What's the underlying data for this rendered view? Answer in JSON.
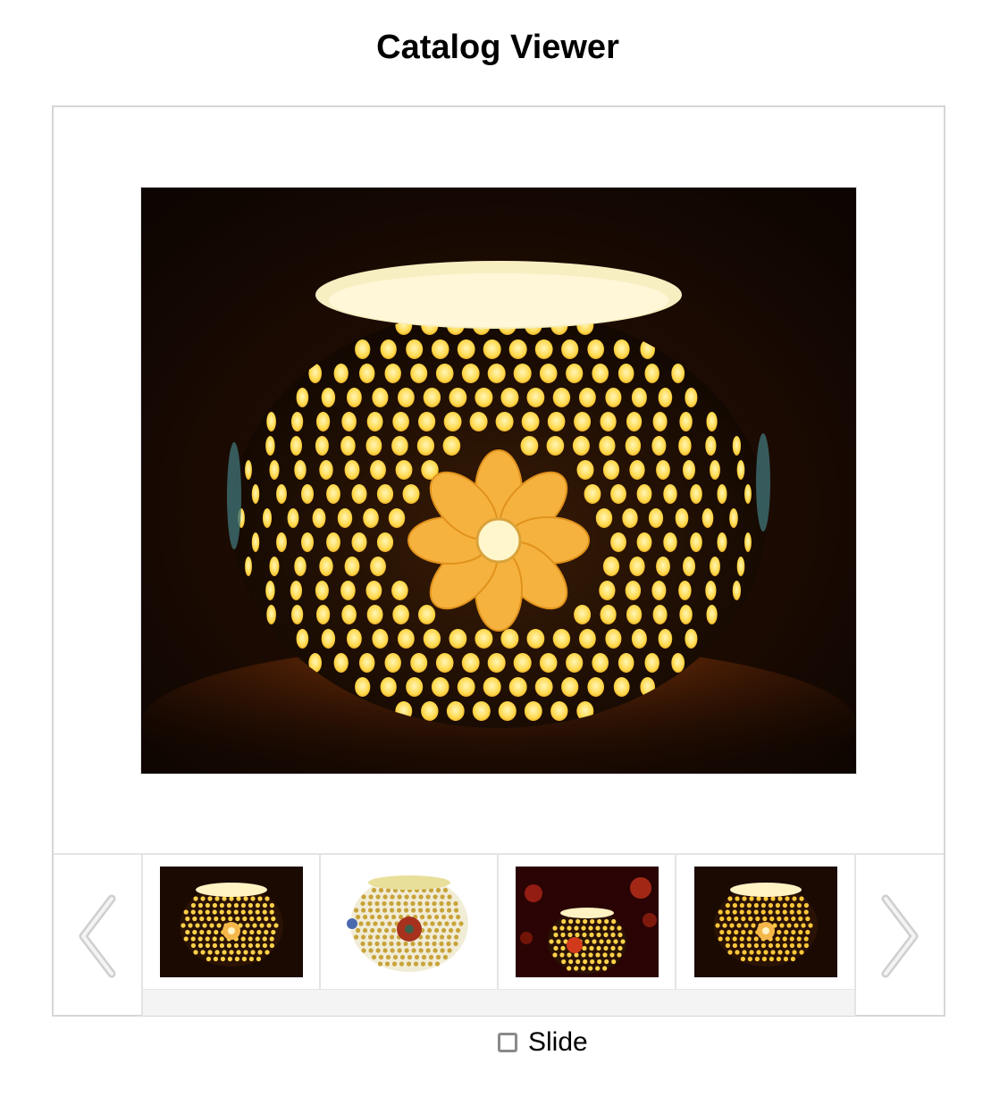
{
  "title": "Catalog Viewer",
  "main_image": {
    "alt": "Mosaic glass tea light candle holder, glowing amber with polka-dot pattern and flower motif"
  },
  "nav": {
    "prev_icon": "chevron-left-icon",
    "next_icon": "chevron-right-icon"
  },
  "thumbnails": [
    {
      "alt": "Amber dotted candle holder, flower motif"
    },
    {
      "alt": "White mosaic candle holder with red flower"
    },
    {
      "alt": "Candle holder on red bokeh background"
    },
    {
      "alt": "Amber dotted candle holder, flower motif (alt)"
    }
  ],
  "slide_toggle": {
    "label": "Slide",
    "checked": false
  },
  "colors": {
    "frame_border": "#d6d6d6",
    "divider": "#e4e4e4",
    "chevron": "#cfcfcf",
    "glow": "#ffd24a"
  }
}
